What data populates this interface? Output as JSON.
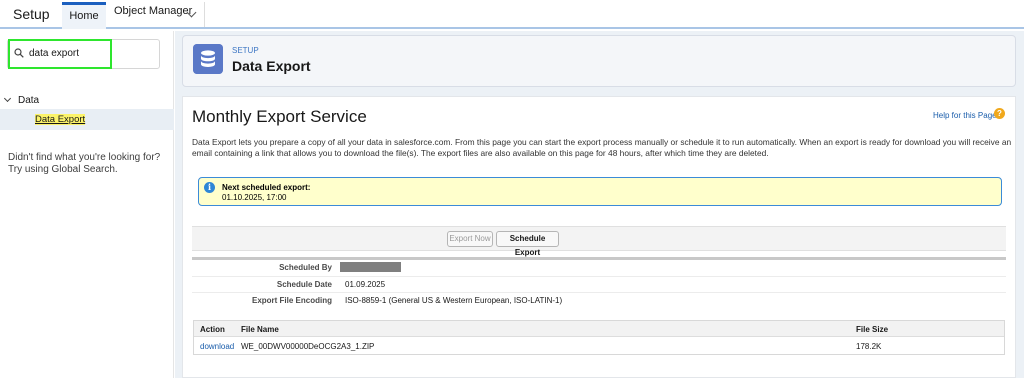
{
  "topbar": {
    "app_title": "Setup",
    "tabs": [
      {
        "label": "Home"
      },
      {
        "label": "Object Manager"
      }
    ]
  },
  "sidebar": {
    "search_value": "data export",
    "tree": {
      "group_label": "Data",
      "item_label": "Data Export"
    },
    "help_line1": "Didn't find what you're looking for?",
    "help_line2": "Try using Global Search."
  },
  "header": {
    "eyebrow": "SETUP",
    "title": "Data Export"
  },
  "main": {
    "heading": "Monthly Export Service",
    "help_link": "Help for this Page",
    "description": "Data Export lets you prepare a copy of all your data in salesforce.com. From this page you can start the export process manually or schedule it to run automatically. When an export is ready for download you will receive an email containing a link that allows you to download the file(s). The export files are also available on this page for 48 hours, after which time they are deleted.",
    "notice": {
      "title": "Next scheduled export:",
      "date": "01.10.2025, 17:00"
    },
    "buttons": {
      "export_now": "Export Now",
      "schedule_export": "Schedule Export"
    },
    "details": {
      "scheduled_by_label": "Scheduled By",
      "schedule_date_label": "Schedule Date",
      "schedule_date_value": "01.09.2025",
      "encoding_label": "Export File Encoding",
      "encoding_value": "ISO-8859-1 (General US & Western European, ISO-LATIN-1)"
    },
    "files_table": {
      "columns": [
        "Action",
        "File Name",
        "File Size"
      ],
      "rows": [
        {
          "action": "download",
          "file_name": "WE_00DWV00000DeOCG2A3_1.ZIP",
          "file_size": "178.2K"
        }
      ]
    }
  },
  "colors": {
    "accent": "#1b5fbf",
    "highlight_border": "#2ee62e",
    "notice_bg": "#ffffcc",
    "header_icon": "#5a78c7"
  }
}
